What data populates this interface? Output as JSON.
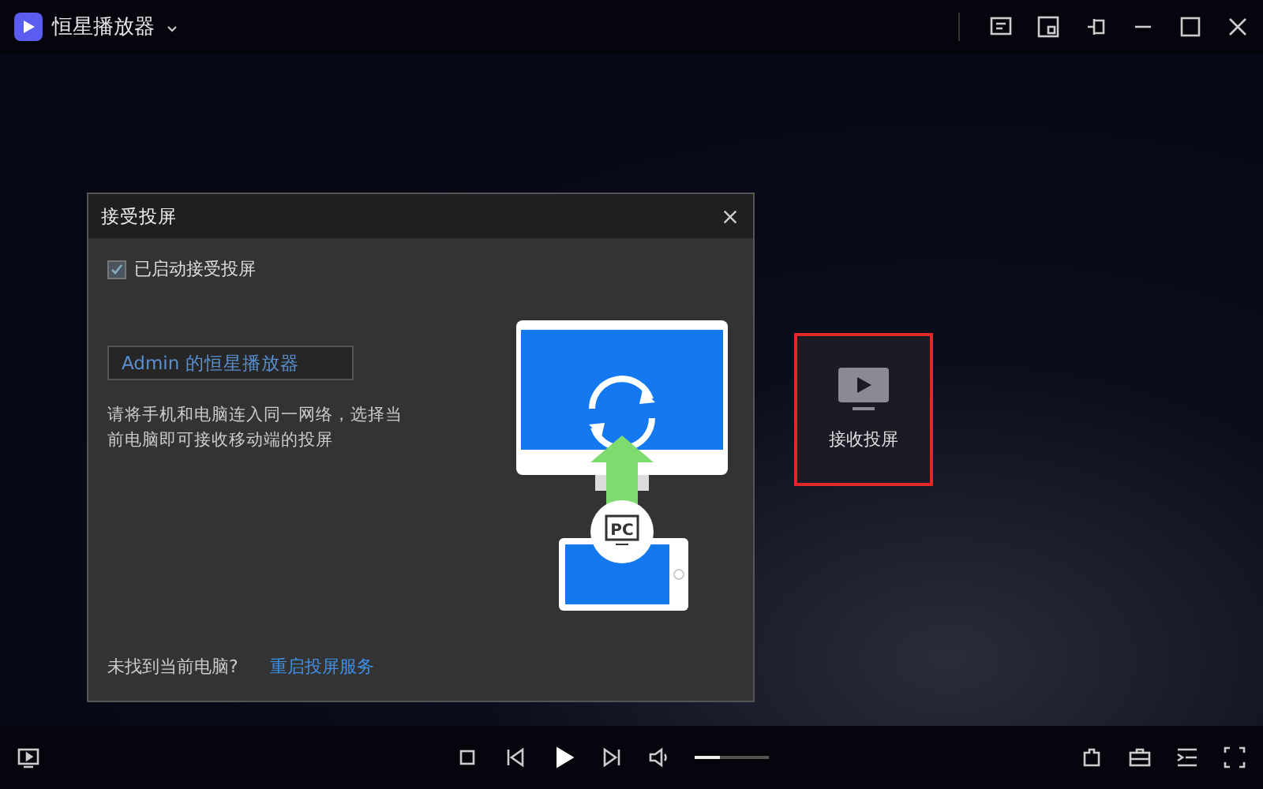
{
  "app": {
    "title": "恒星播放器"
  },
  "dialog": {
    "title": "接受投屏",
    "checkbox": {
      "label": "已启动接受投屏",
      "checked": true
    },
    "device_name": {
      "value": "Admin 的恒星播放器"
    },
    "hint": "请将手机和电脑连入同一网络，选择当前电脑即可接收移动端的投屏",
    "badge": "PC",
    "footer_question": "未找到当前电脑?",
    "footer_link": "重启投屏服务"
  },
  "receive_button": {
    "label": "接收投屏",
    "highlighted": true
  },
  "volume": {
    "level": 0.35
  }
}
